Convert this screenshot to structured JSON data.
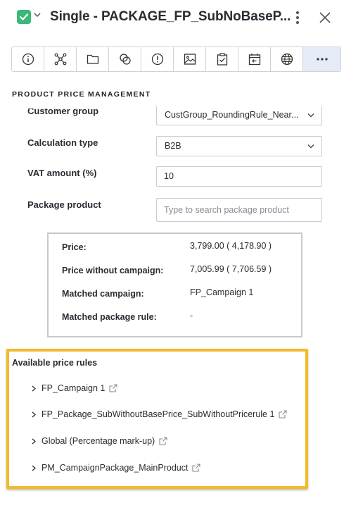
{
  "header": {
    "title": "Single - PACKAGE_FP_SubNoBaseP...",
    "status_color": "#3cb878"
  },
  "toolbar": {
    "buttons": [
      {
        "icon": "info-icon"
      },
      {
        "icon": "network-icon"
      },
      {
        "icon": "folder-icon"
      },
      {
        "icon": "link-icon"
      },
      {
        "icon": "alert-icon"
      },
      {
        "icon": "image-icon"
      },
      {
        "icon": "clipboard-check-icon"
      },
      {
        "icon": "calendar-icon"
      },
      {
        "icon": "globe-icon"
      },
      {
        "icon": "more-icon"
      }
    ]
  },
  "section": {
    "title": "PRODUCT PRICE MANAGEMENT"
  },
  "form": {
    "customer_group_label": "Customer group",
    "customer_group_value": "CustGroup_RoundingRule_Near...",
    "calc_type_label": "Calculation type",
    "calc_type_value": "B2B",
    "vat_label": "VAT amount (%)",
    "vat_value": "10",
    "package_label": "Package product",
    "package_placeholder": "Type to search package product"
  },
  "info": {
    "price_label": "Price:",
    "price_value": "3,799.00 ( 4,178.90 )",
    "no_campaign_label": "Price without campaign:",
    "no_campaign_value": "7,005.99 ( 7,706.59 )",
    "matched_campaign_label": "Matched campaign:",
    "matched_campaign_value": "FP_Campaign 1",
    "matched_rule_label": "Matched package rule:",
    "matched_rule_value": "-"
  },
  "rules": {
    "title": "Available price rules",
    "items": [
      {
        "label": "FP_Campaign 1"
      },
      {
        "label": "FP_Package_SubWithoutBasePrice_SubWithoutPricerule 1"
      },
      {
        "label": "Global (Percentage mark-up)"
      },
      {
        "label": "PM_CampaignPackage_MainProduct"
      }
    ],
    "highlight_color": "#f3b928"
  }
}
